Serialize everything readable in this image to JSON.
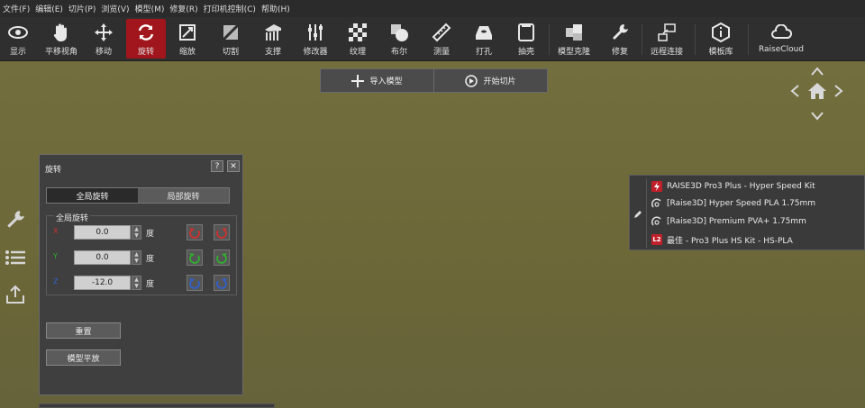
{
  "menu": [
    "文件(F)",
    "编辑(E)",
    "切片(P)",
    "浏览(V)",
    "模型(M)",
    "修复(R)",
    "打印机控制(C)",
    "帮助(H)"
  ],
  "toolbar": {
    "show": "显示",
    "pan_view": "平移视角",
    "move": "移动",
    "rotate": "旋转",
    "scale": "缩放",
    "cut": "切割",
    "support": "支撑",
    "modifier": "修改器",
    "texture": "纹理",
    "boolean": "布尔",
    "measure": "测量",
    "punch": "打孔",
    "shell": "抽壳",
    "clone": "模型克隆",
    "repair": "修复",
    "remote": "远程连接",
    "templates": "模板库",
    "cloud": "RaiseCloud"
  },
  "slicebar": {
    "import": "导入模型",
    "start": "开始切片"
  },
  "rotate_panel": {
    "title": "旋转",
    "help": "?",
    "close": "✕",
    "tab_global": "全局旋转",
    "tab_local": "局部旋转",
    "group_label": "全局旋转",
    "unit": "度",
    "rows": [
      {
        "axis": "X",
        "value": "0.0",
        "color": "#d03030"
      },
      {
        "axis": "Y",
        "value": "0.0",
        "color": "#30b030"
      },
      {
        "axis": "Z",
        "value": "-12.0",
        "color": "#3060d0"
      }
    ],
    "reset": "重置",
    "lay_flat": "模型平放"
  },
  "material_panel": {
    "items": [
      {
        "icon": "raise3d-logo-icon",
        "text": "RAISE3D Pro3 Plus - Hyper Speed Kit",
        "badge": ""
      },
      {
        "icon": "material-icon",
        "text": "[Raise3D] Hyper Speed PLA 1.75mm",
        "badge": ""
      },
      {
        "icon": "material-icon",
        "text": "[Raise3D] Premium PVA+ 1.75mm",
        "badge": ""
      },
      {
        "icon": "profile-badge-icon",
        "text": "最佳 - Pro3 Plus HS Kit - HS-PLA",
        "badge": "L2"
      }
    ]
  },
  "colors": {
    "accent": "#a0161c",
    "viewport": "#6f6b3a"
  }
}
